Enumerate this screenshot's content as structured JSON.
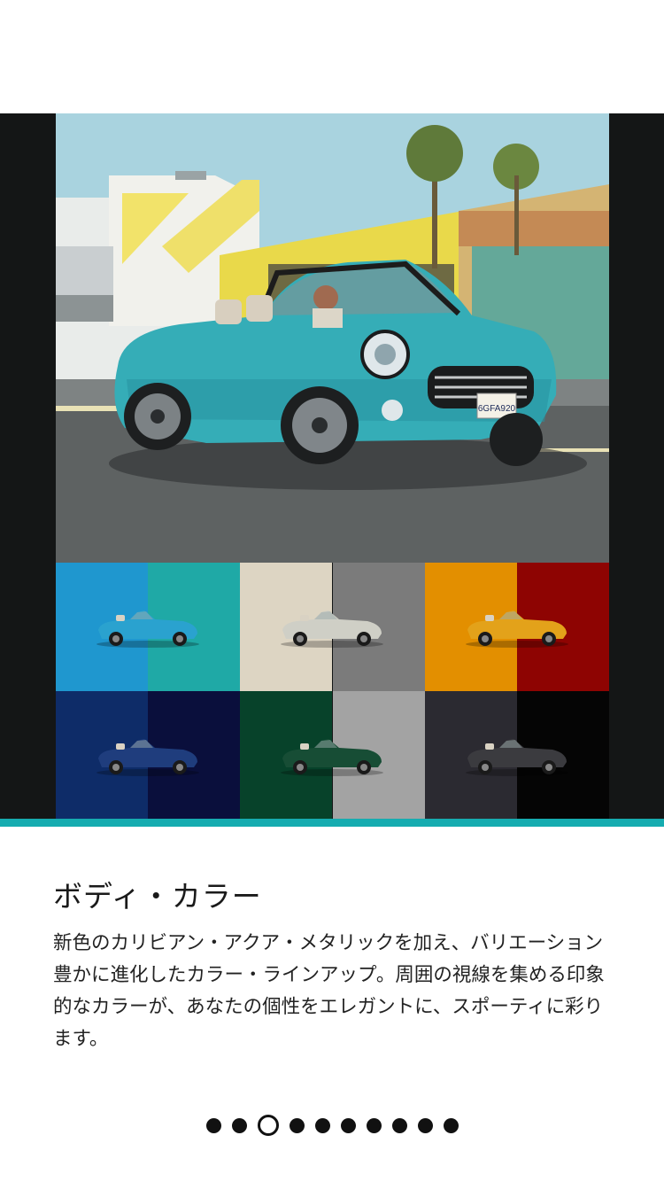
{
  "hero": {
    "license_plate": "6GFA920",
    "image_description": "turquoise-convertible-photo"
  },
  "swatches": [
    {
      "id": "swatch-1",
      "left": "#1f97cf",
      "right": "#1fa9a6",
      "car": "#2aa2cf"
    },
    {
      "id": "swatch-2",
      "left": "#ddd5c3",
      "right": "#7b7b7b",
      "car": "#cfcfc6"
    },
    {
      "id": "swatch-3",
      "left": "#e38f00",
      "right": "#8e0402",
      "car": "#e3a21a"
    },
    {
      "id": "swatch-4",
      "left": "#0e2c68",
      "right": "#0a0f3c",
      "car": "#1f3d7d"
    },
    {
      "id": "swatch-5",
      "left": "#07422a",
      "right": "#a3a3a3",
      "car": "#174d35"
    },
    {
      "id": "swatch-6",
      "left": "#2b2a31",
      "right": "#050505",
      "car": "#3b3b3f"
    }
  ],
  "accent_color": "#16acb0",
  "section": {
    "title": "ボディ・カラー",
    "description": "新色のカリビアン・アクア・メタリックを加え、バリエーション豊かに進化したカラー・ラインアップ。周囲の視線を集める印象的なカラーが、あなたの個性をエレガントに、スポーティに彩ります。"
  },
  "pager": {
    "total": 10,
    "active_index": 2
  }
}
